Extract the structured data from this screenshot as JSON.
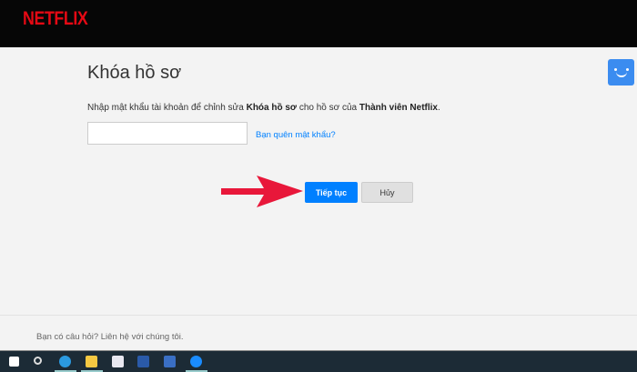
{
  "header": {
    "logo": "NETFLIX"
  },
  "main": {
    "title": "Khóa hồ sơ",
    "desc_prefix": "Nhập mật khẩu tài khoản để chỉnh sửa ",
    "desc_bold1": "Khóa hồ sơ",
    "desc_mid": " cho hồ sơ của ",
    "desc_bold2": "Thành viên Netflix",
    "desc_end": ".",
    "password_value": "",
    "forgot_link": "Bạn quên mật khẩu?",
    "continue_label": "Tiếp tục",
    "cancel_label": "Hủy"
  },
  "footer": {
    "text": "Bạn có câu hỏi? Liên hệ với chúng tôi."
  },
  "colors": {
    "brand": "#e50914",
    "accent": "#0080ff",
    "arrow": "#e8173a"
  },
  "taskbar": {
    "icons": [
      "windows-icon",
      "search-icon",
      "edge-icon",
      "file-explorer-icon",
      "store-icon",
      "word-icon",
      "app-icon",
      "zalo-icon"
    ]
  }
}
